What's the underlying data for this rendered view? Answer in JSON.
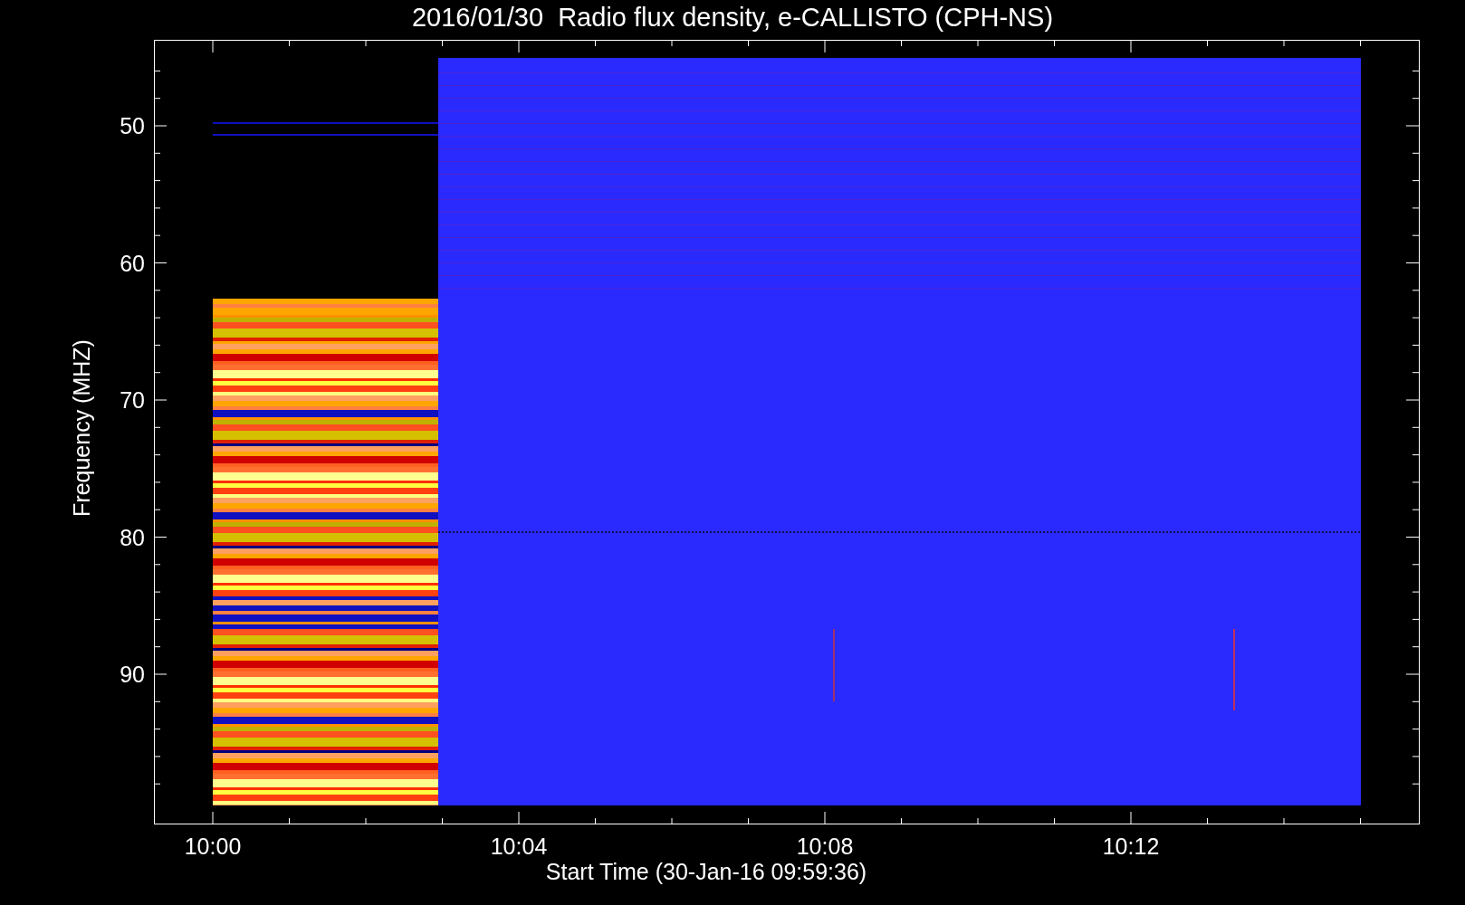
{
  "title": "2016/01/30  Radio flux density, e-CALLISTO (CPH-NS)",
  "x_axis": {
    "label": "Start Time (30-Jan-16 09:59:36)",
    "ticks": [
      "10:00",
      "10:04",
      "10:08",
      "10:12"
    ]
  },
  "y_axis": {
    "label": "Frequency (MHZ)",
    "ticks": [
      "50",
      "60",
      "70",
      "80",
      "90"
    ]
  }
}
